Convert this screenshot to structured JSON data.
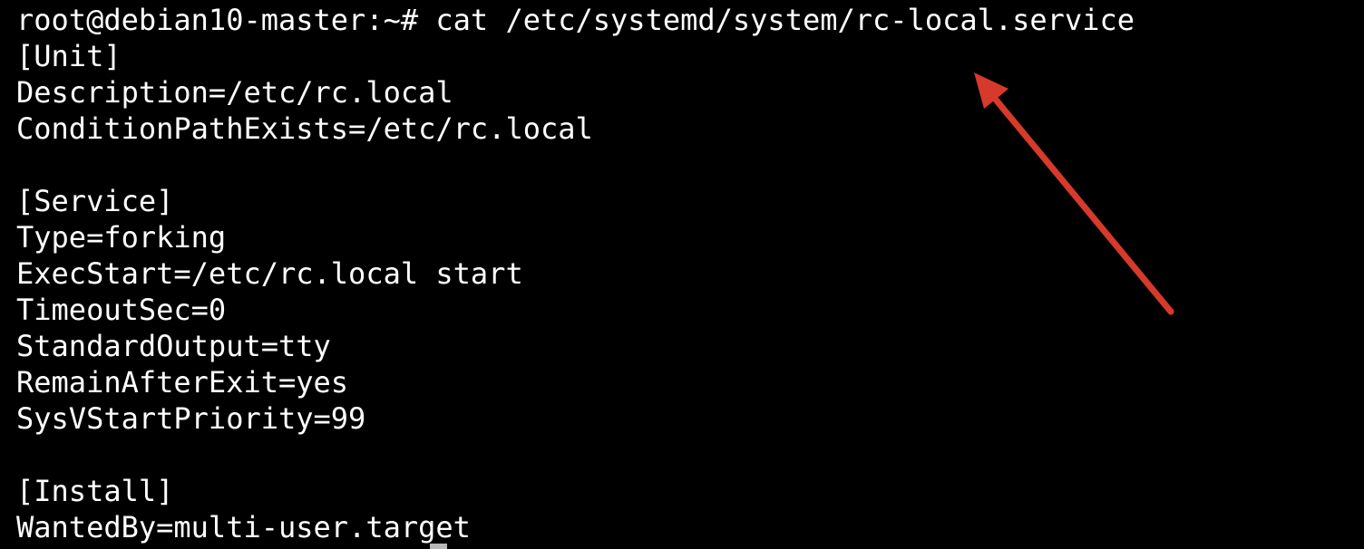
{
  "terminal": {
    "lines": [
      "root@debian10-master:~# cat /etc/systemd/system/rc-local.service",
      "[Unit]",
      "Description=/etc/rc.local",
      "ConditionPathExists=/etc/rc.local",
      "",
      "[Service]",
      "Type=forking",
      "ExecStart=/etc/rc.local start",
      "TimeoutSec=0",
      "StandardOutput=tty",
      "RemainAfterExit=yes",
      "SysVStartPriority=99",
      "",
      "[Install]",
      "WantedBy=multi-user.target"
    ]
  },
  "colors": {
    "background": "#000000",
    "text": "#ffffff",
    "annotation_arrow": "#d63a2b",
    "cursor": "#b8b8b8"
  },
  "icons": {
    "annotation": "arrow-icon"
  }
}
